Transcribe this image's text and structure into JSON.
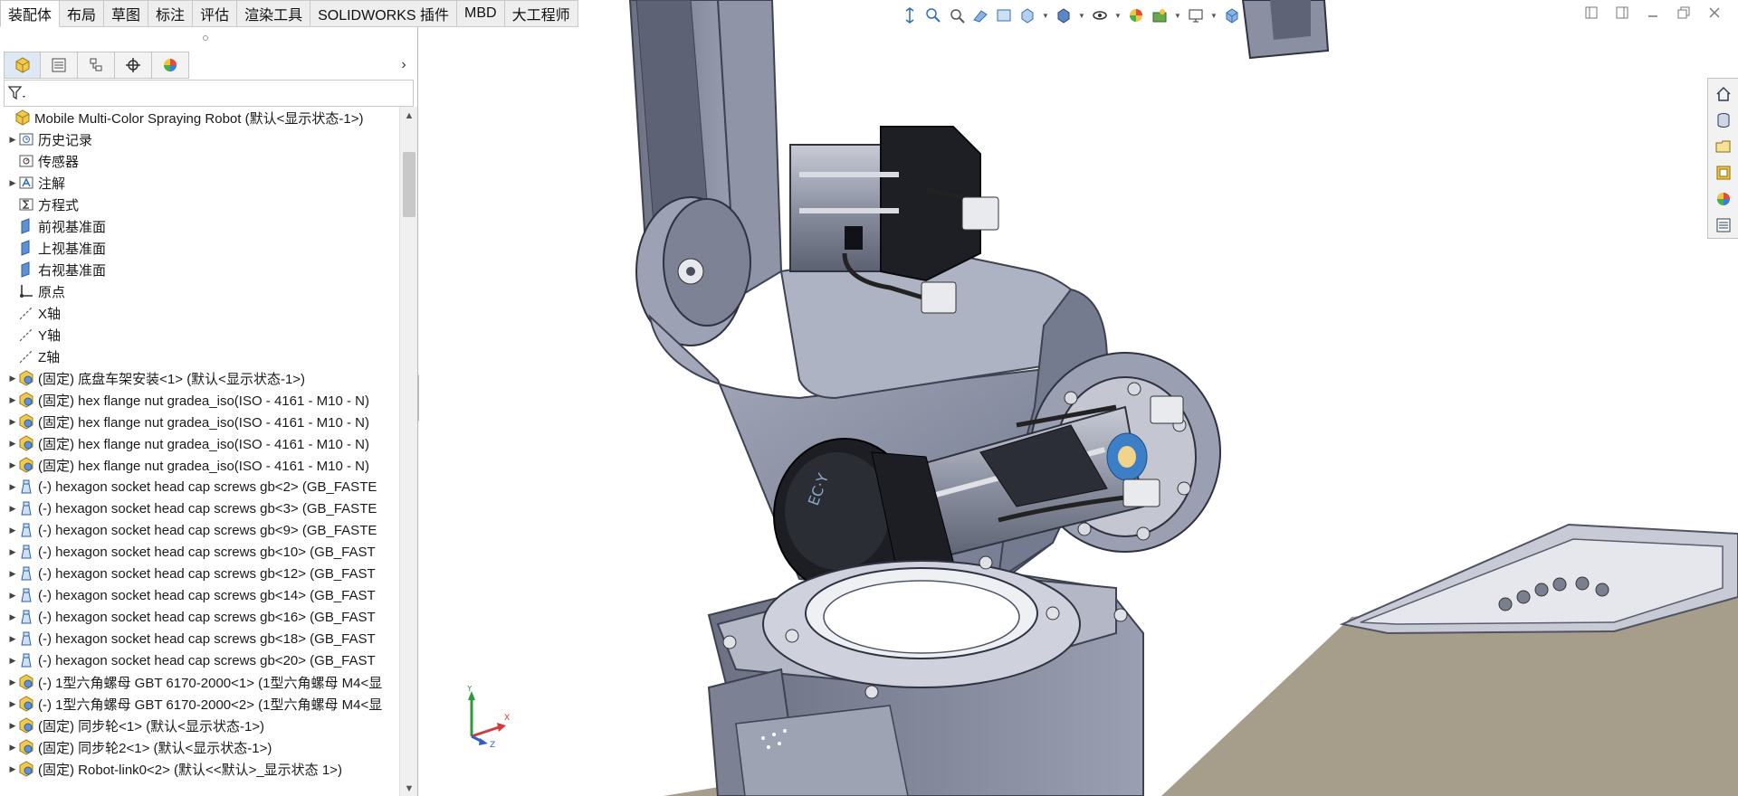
{
  "command_tabs": [
    "装配体",
    "布局",
    "草图",
    "标注",
    "评估",
    "渲染工具",
    "SOLIDWORKS 插件",
    "MBD",
    "大工程师"
  ],
  "active_tab": 0,
  "feature_tree": {
    "root": "Mobile Multi-Color Spraying Robot  (默认<显示状态-1>)",
    "items": [
      {
        "label": "历史记录",
        "icon": "history-icon"
      },
      {
        "label": "传感器",
        "icon": "sensor-icon"
      },
      {
        "label": "注解",
        "icon": "annotation-icon"
      },
      {
        "label": "方程式",
        "icon": "equation-icon"
      },
      {
        "label": "前视基准面",
        "icon": "plane-icon"
      },
      {
        "label": "上视基准面",
        "icon": "plane-icon"
      },
      {
        "label": "右视基准面",
        "icon": "plane-icon"
      },
      {
        "label": "原点",
        "icon": "origin-icon"
      },
      {
        "label": "X轴",
        "icon": "axis-icon"
      },
      {
        "label": "Y轴",
        "icon": "axis-icon"
      },
      {
        "label": "Z轴",
        "icon": "axis-icon"
      },
      {
        "label": "(固定) 底盘车架安装<1> (默认<显示状态-1>)",
        "icon": "subassembly-icon"
      },
      {
        "label": "(固定) hex flange nut gradea_iso(ISO - 4161 - M10 - N)",
        "icon": "subassembly-icon"
      },
      {
        "label": "(固定) hex flange nut gradea_iso(ISO - 4161 - M10 - N)",
        "icon": "subassembly-icon"
      },
      {
        "label": "(固定) hex flange nut gradea_iso(ISO - 4161 - M10 - N)",
        "icon": "subassembly-icon"
      },
      {
        "label": "(固定) hex flange nut gradea_iso(ISO - 4161 - M10 - N)",
        "icon": "subassembly-icon"
      },
      {
        "label": "(-) hexagon socket head cap screws gb<2> (GB_FASTE",
        "icon": "part-icon"
      },
      {
        "label": "(-) hexagon socket head cap screws gb<3> (GB_FASTE",
        "icon": "part-icon"
      },
      {
        "label": "(-) hexagon socket head cap screws gb<9> (GB_FASTE",
        "icon": "part-icon"
      },
      {
        "label": "(-) hexagon socket head cap screws gb<10> (GB_FAST",
        "icon": "part-icon"
      },
      {
        "label": "(-) hexagon socket head cap screws gb<12> (GB_FAST",
        "icon": "part-icon"
      },
      {
        "label": "(-) hexagon socket head cap screws gb<14> (GB_FAST",
        "icon": "part-icon"
      },
      {
        "label": "(-) hexagon socket head cap screws gb<16> (GB_FAST",
        "icon": "part-icon"
      },
      {
        "label": "(-) hexagon socket head cap screws gb<18> (GB_FAST",
        "icon": "part-icon"
      },
      {
        "label": "(-) hexagon socket head cap screws gb<20> (GB_FAST",
        "icon": "part-icon"
      },
      {
        "label": "(-) 1型六角螺母 GBT 6170-2000<1> (1型六角螺母 M4<显",
        "icon": "subassembly-icon"
      },
      {
        "label": "(-) 1型六角螺母 GBT 6170-2000<2> (1型六角螺母 M4<显",
        "icon": "subassembly-icon"
      },
      {
        "label": "(固定) 同步轮<1> (默认<显示状态-1>)",
        "icon": "subassembly-icon"
      },
      {
        "label": "(固定) 同步轮2<1> (默认<显示状态-1>)",
        "icon": "subassembly-icon"
      },
      {
        "label": "(固定) Robot-link0<2> (默认<<默认>_显示状态 1>)",
        "icon": "subassembly-icon"
      }
    ]
  },
  "colors": {
    "part_grey": "#8d93a6",
    "part_dark": "#4f5363",
    "motor_black": "#1d1f24",
    "floor": "#a59c8a",
    "accent_blue": "#2f6fb5"
  },
  "triad_labels": {
    "x": "X",
    "y": "Y",
    "z": "Z"
  }
}
